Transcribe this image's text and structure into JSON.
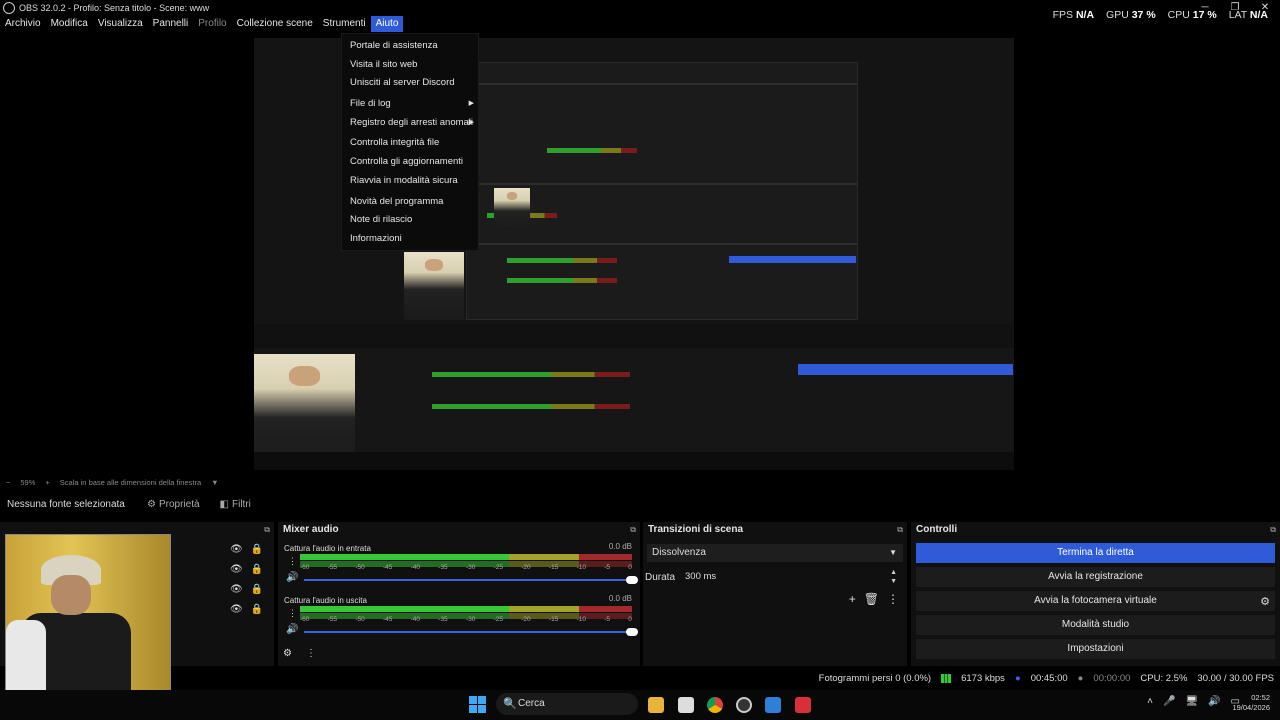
{
  "window": {
    "title": "OBS 32.0.2 - Profilo: Senza titolo - Scene: www",
    "controls": [
      "─",
      "❐",
      "✕"
    ]
  },
  "menu": {
    "items": [
      "Archivio",
      "Modifica",
      "Visualizza",
      "Pannelli",
      "Profilo",
      "Collezione scene",
      "Strumenti",
      "Aiuto"
    ]
  },
  "stats": {
    "fps_label": "FPS",
    "fps_value": "N/A",
    "gpu_label": "GPU",
    "gpu_value": "37 %",
    "cpu_label": "CPU",
    "cpu_value": "17 %",
    "lat_label": "LAT",
    "lat_value": "N/A"
  },
  "help_menu": {
    "items": [
      "Portale di assistenza",
      "Visita il sito web",
      "Unisciti al server Discord",
      "File di log",
      "Registro degli arresti anomali",
      "Controlla integrità file",
      "Controlla gli aggiornamenti",
      "Riavvia in modalità sicura",
      "Novità del programma",
      "Note di rilascio",
      "Informazioni"
    ]
  },
  "zoom": {
    "minus": "−",
    "value": "59%",
    "plus": "+",
    "mode": "Scala in base alle dimensioni della finestra"
  },
  "source_toolbar": {
    "no_selection": "Nessuna fonte selezionata",
    "properties": "Proprietà",
    "filters": "Filtri"
  },
  "mixer": {
    "title": "Mixer audio",
    "tracks": [
      {
        "name": "Cattura l'audio in entrata",
        "db": "0.0 dB"
      },
      {
        "name": "Cattura l'audio in uscita",
        "db": "0.0 dB"
      }
    ],
    "scale": [
      "-60",
      "-55",
      "-50",
      "-45",
      "-40",
      "-35",
      "-30",
      "-25",
      "-20",
      "-15",
      "-10",
      "-5",
      "0"
    ]
  },
  "transitions": {
    "title": "Transizioni di scena",
    "selected": "Dissolvenza",
    "duration_label": "Durata",
    "duration_value": "300 ms"
  },
  "controls": {
    "title": "Controlli",
    "buttons": [
      "Termina la diretta",
      "Avvia la registrazione",
      "Avvia la fotocamera virtuale",
      "Modalità studio",
      "Impostazioni"
    ]
  },
  "status": {
    "dropped": "Fotogrammi persi 0 (0.0%)",
    "bitrate": "6173 kbps",
    "stream_time": "00:45:00",
    "rec_time": "00:00:00",
    "cpu": "CPU: 2.5%",
    "fps": "30.00 / 30.00 FPS"
  },
  "taskbar": {
    "search_label": "Cerca",
    "time": "02:52",
    "date": "19/04/2026"
  },
  "colors": {
    "accent": "#2f5bd9",
    "meter_green": "#37c837",
    "meter_yellow": "#a3a32a",
    "meter_red": "#a32a2a"
  }
}
